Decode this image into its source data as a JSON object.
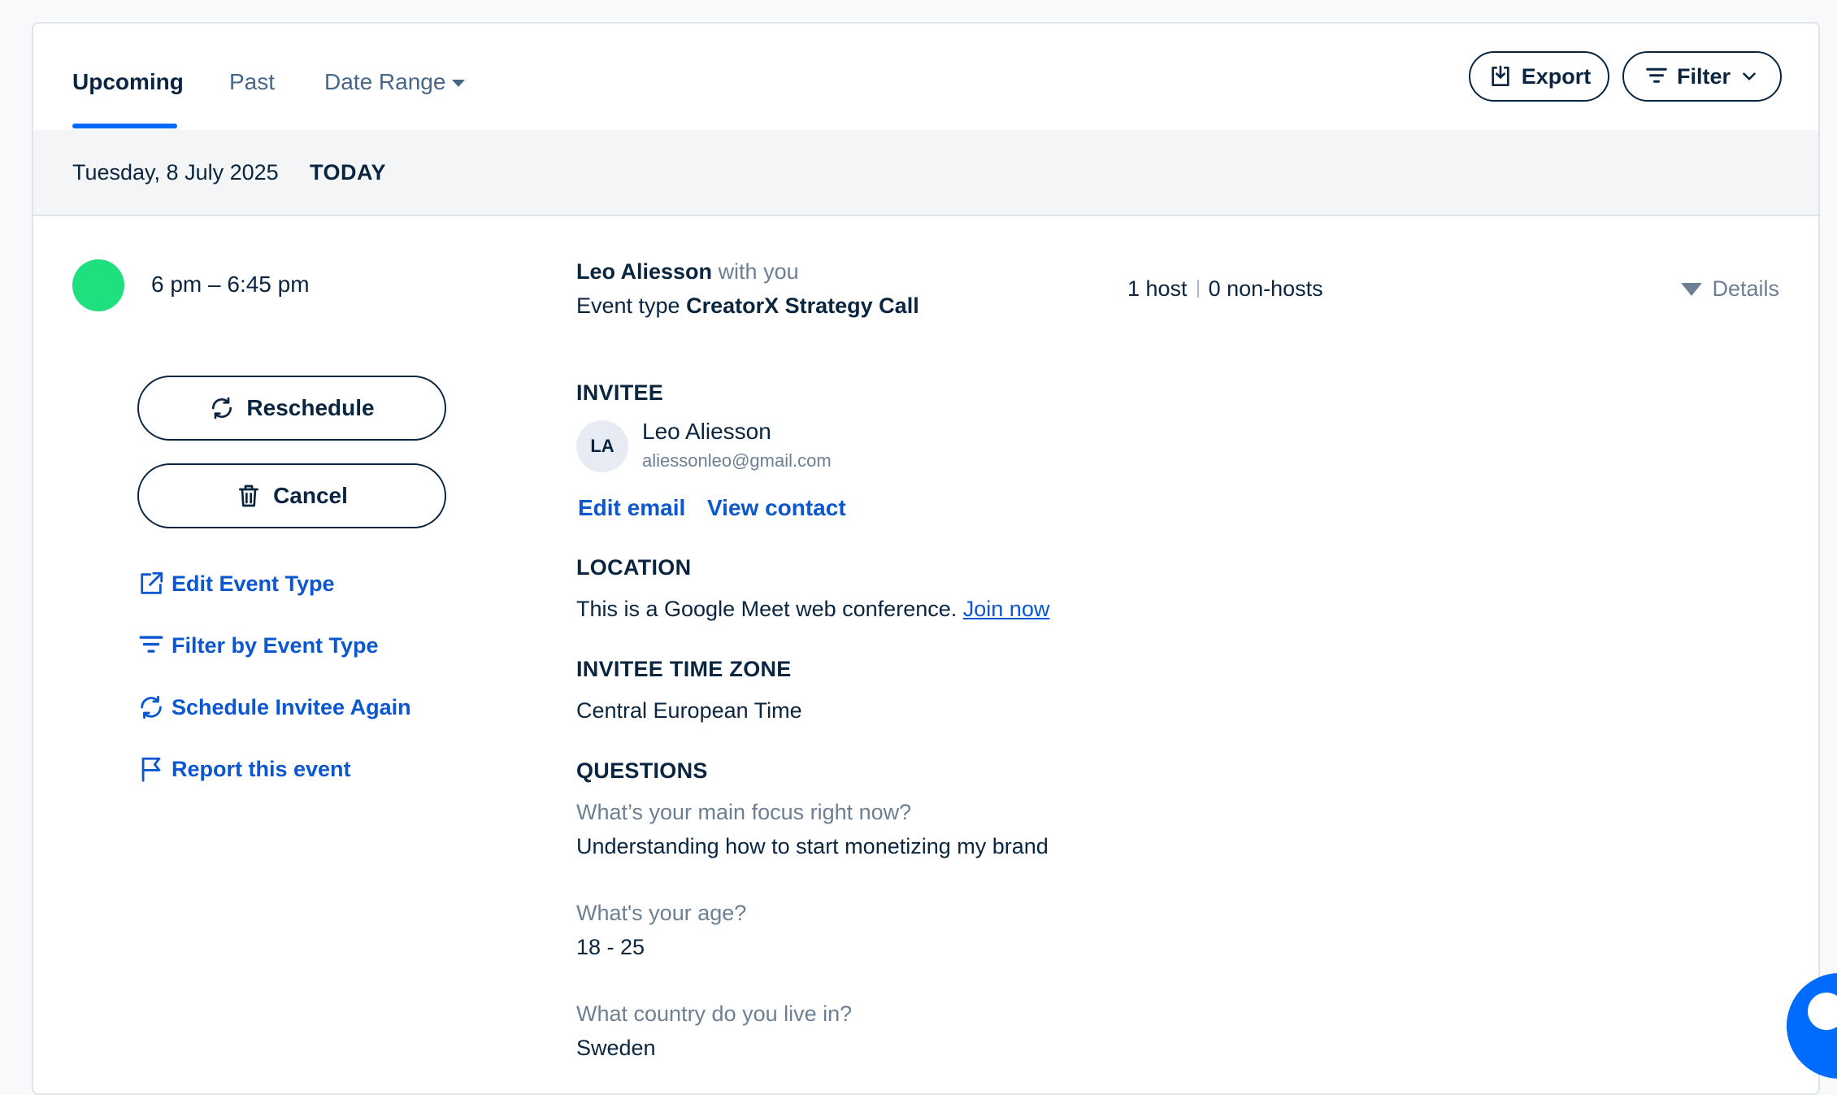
{
  "tabs": {
    "upcoming": "Upcoming",
    "past": "Past",
    "date_range": "Date Range"
  },
  "toolbar": {
    "export_label": "Export",
    "filter_label": "Filter"
  },
  "day_header": {
    "date": "Tuesday, 8 July 2025",
    "today": "TODAY"
  },
  "event": {
    "status_color": "#1ee07f",
    "time": "6 pm – 6:45 pm",
    "invitee_name": "Leo Aliesson",
    "with_you": "with you",
    "event_type_prefix": "Event type",
    "event_type_name": "CreatorX Strategy Call",
    "hosts": "1 host",
    "non_hosts": "0 non-hosts",
    "details_label": "Details"
  },
  "actions": {
    "reschedule": "Reschedule",
    "cancel": "Cancel",
    "edit_event_type": "Edit Event Type",
    "filter_by_event_type": "Filter by Event Type",
    "schedule_invitee_again": "Schedule Invitee Again",
    "report_event": "Report this event"
  },
  "invitee": {
    "heading": "INVITEE",
    "initials": "LA",
    "name": "Leo Aliesson",
    "email": "aliessonleo@gmail.com",
    "edit_email": "Edit email",
    "view_contact": "View contact"
  },
  "location": {
    "heading": "LOCATION",
    "text": "This is a Google Meet web conference.",
    "join_now": "Join now"
  },
  "timezone": {
    "heading": "INVITEE TIME ZONE",
    "value": "Central European Time"
  },
  "questions": {
    "heading": "QUESTIONS",
    "items": [
      {
        "question": "What’s your main focus right now?",
        "answer": "Understanding how to start monetizing my brand"
      },
      {
        "question": "What's your age?",
        "answer": "18 - 25"
      },
      {
        "question": "What country do you live in?",
        "answer": "Sweden"
      }
    ]
  },
  "colors": {
    "accent": "#006bff",
    "link": "#0b57d0",
    "text": "#0a2540",
    "muted": "#6d7f92"
  }
}
